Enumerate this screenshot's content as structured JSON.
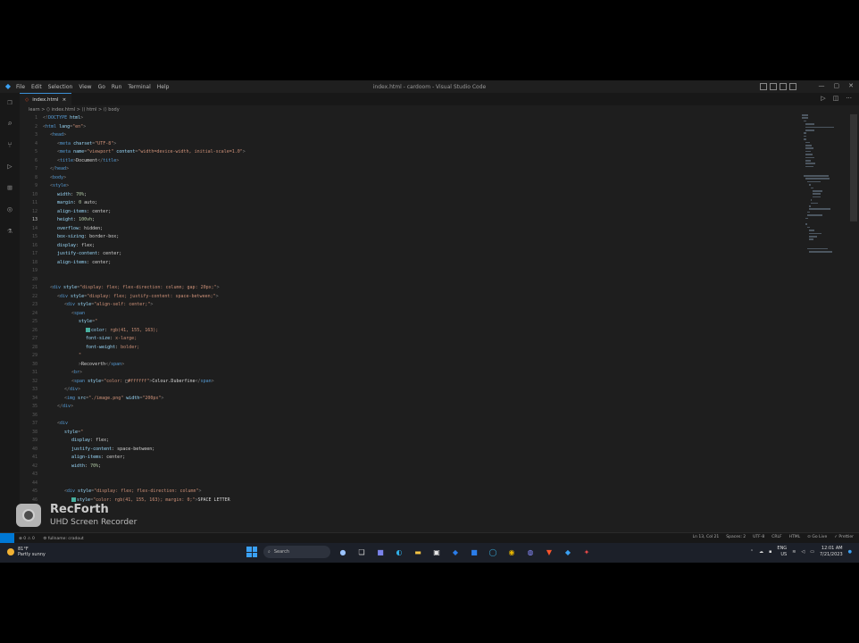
{
  "window": {
    "title": "index.html - cardoom - Visual Studio Code",
    "menu": [
      "File",
      "Edit",
      "Selection",
      "View",
      "Go",
      "Run",
      "Terminal",
      "Help"
    ]
  },
  "tabs": [
    {
      "label": "index.html",
      "icon": "html-file-icon",
      "close": "×"
    }
  ],
  "breadcrumb": "learn > ⟨⟩ index.html > ⟨⟩ html > ⟨⟩ body",
  "editor": {
    "active_line": 13,
    "lines": [
      {
        "n": 1,
        "indent": 0,
        "segs": [
          [
            "t-punc",
            "<!"
          ],
          [
            "t-tag",
            "DOCTYPE"
          ],
          [
            "t-attr",
            " html"
          ],
          [
            "t-punc",
            ">"
          ]
        ]
      },
      {
        "n": 2,
        "indent": 0,
        "segs": [
          [
            "t-punc",
            "<"
          ],
          [
            "t-tag",
            "html"
          ],
          [
            "t-attr",
            " lang"
          ],
          [
            "t-punc",
            "="
          ],
          [
            "t-str",
            "\"en\""
          ],
          [
            "t-punc",
            ">"
          ]
        ]
      },
      {
        "n": 3,
        "indent": 1,
        "segs": [
          [
            "t-punc",
            "<"
          ],
          [
            "t-tag",
            "head"
          ],
          [
            "t-punc",
            ">"
          ]
        ]
      },
      {
        "n": 4,
        "indent": 2,
        "segs": [
          [
            "t-punc",
            "<"
          ],
          [
            "t-tag",
            "meta"
          ],
          [
            "t-attr",
            " charset"
          ],
          [
            "t-punc",
            "="
          ],
          [
            "t-str",
            "\"UTF-8\""
          ],
          [
            "t-punc",
            ">"
          ]
        ]
      },
      {
        "n": 5,
        "indent": 2,
        "segs": [
          [
            "t-punc",
            "<"
          ],
          [
            "t-tag",
            "meta"
          ],
          [
            "t-attr",
            " name"
          ],
          [
            "t-punc",
            "="
          ],
          [
            "t-str",
            "\"viewport\""
          ],
          [
            "t-attr",
            " content"
          ],
          [
            "t-punc",
            "="
          ],
          [
            "t-str",
            "\"width=device-width, initial-scale=1.0\""
          ],
          [
            "t-punc",
            ">"
          ]
        ]
      },
      {
        "n": 6,
        "indent": 2,
        "segs": [
          [
            "t-punc",
            "<"
          ],
          [
            "t-tag",
            "title"
          ],
          [
            "t-punc",
            ">"
          ],
          [
            "t-txt",
            "Document"
          ],
          [
            "t-punc",
            "</"
          ],
          [
            "t-tag",
            "title"
          ],
          [
            "t-punc",
            ">"
          ]
        ]
      },
      {
        "n": 7,
        "indent": 1,
        "segs": [
          [
            "t-punc",
            "</"
          ],
          [
            "t-tag",
            "head"
          ],
          [
            "t-punc",
            ">"
          ]
        ]
      },
      {
        "n": 8,
        "indent": 1,
        "segs": [
          [
            "t-punc",
            "<"
          ],
          [
            "t-tag",
            "body"
          ],
          [
            "t-punc",
            ">"
          ]
        ]
      },
      {
        "n": 9,
        "indent": 1,
        "segs": [
          [
            "t-punc",
            "<"
          ],
          [
            "t-tag",
            "style"
          ],
          [
            "t-punc",
            ">"
          ]
        ]
      },
      {
        "n": 10,
        "indent": 2,
        "segs": [
          [
            "t-prop",
            "width"
          ],
          [
            "t-txt",
            ": "
          ],
          [
            "t-num",
            "70%"
          ],
          [
            "t-txt",
            ";"
          ]
        ]
      },
      {
        "n": 11,
        "indent": 2,
        "segs": [
          [
            "t-prop",
            "margin"
          ],
          [
            "t-txt",
            ": "
          ],
          [
            "t-num",
            "0"
          ],
          [
            "t-txt",
            " auto;"
          ]
        ]
      },
      {
        "n": 12,
        "indent": 2,
        "segs": [
          [
            "t-prop",
            "align-items"
          ],
          [
            "t-txt",
            ": center;"
          ]
        ]
      },
      {
        "n": 13,
        "indent": 2,
        "segs": [
          [
            "t-prop",
            "height"
          ],
          [
            "t-txt",
            ": "
          ],
          [
            "t-num",
            "100vh"
          ],
          [
            "t-txt",
            ";"
          ]
        ]
      },
      {
        "n": 14,
        "indent": 2,
        "segs": [
          [
            "t-prop",
            "overflow"
          ],
          [
            "t-txt",
            ": hidden;"
          ]
        ]
      },
      {
        "n": 15,
        "indent": 2,
        "segs": [
          [
            "t-prop",
            "box-sizing"
          ],
          [
            "t-txt",
            ": border-box;"
          ]
        ]
      },
      {
        "n": 16,
        "indent": 2,
        "segs": [
          [
            "t-prop",
            "display"
          ],
          [
            "t-txt",
            ": flex;"
          ]
        ]
      },
      {
        "n": 17,
        "indent": 2,
        "segs": [
          [
            "t-prop",
            "justify-content"
          ],
          [
            "t-txt",
            ": center;"
          ]
        ]
      },
      {
        "n": 18,
        "indent": 2,
        "segs": [
          [
            "t-prop",
            "align-items"
          ],
          [
            "t-txt",
            ": center;"
          ]
        ]
      },
      {
        "n": 19,
        "indent": 0,
        "segs": []
      },
      {
        "n": 20,
        "indent": 1,
        "segs": []
      },
      {
        "n": 21,
        "indent": 1,
        "segs": [
          [
            "t-punc",
            "<"
          ],
          [
            "t-tag",
            "div"
          ],
          [
            "t-attr",
            " style"
          ],
          [
            "t-punc",
            "="
          ],
          [
            "t-str",
            "\"display: flex; flex-direction: column; gap: 20px;\""
          ],
          [
            "t-punc",
            ">"
          ]
        ]
      },
      {
        "n": 22,
        "indent": 2,
        "segs": [
          [
            "t-punc",
            "<"
          ],
          [
            "t-tag",
            "div"
          ],
          [
            "t-attr",
            " style"
          ],
          [
            "t-punc",
            "="
          ],
          [
            "t-str",
            "\"display: flex; justify-content: space-between;\""
          ],
          [
            "t-punc",
            ">"
          ]
        ]
      },
      {
        "n": 23,
        "indent": 3,
        "segs": [
          [
            "t-punc",
            "<"
          ],
          [
            "t-tag",
            "div"
          ],
          [
            "t-attr",
            " style"
          ],
          [
            "t-punc",
            "="
          ],
          [
            "t-str",
            "\"align-self: center;\""
          ],
          [
            "t-punc",
            ">"
          ]
        ]
      },
      {
        "n": 24,
        "indent": 4,
        "segs": [
          [
            "t-punc",
            "<"
          ],
          [
            "t-tag",
            "span"
          ]
        ]
      },
      {
        "n": 25,
        "indent": 5,
        "segs": [
          [
            "t-attr",
            "style"
          ],
          [
            "t-punc",
            "="
          ],
          [
            "t-str",
            "\""
          ]
        ]
      },
      {
        "n": 26,
        "indent": 6,
        "swatch": true,
        "segs": [
          [
            "t-prop",
            "color"
          ],
          [
            "t-txt",
            ": "
          ],
          [
            "t-str",
            "rgb(41, 155, 163);"
          ]
        ]
      },
      {
        "n": 27,
        "indent": 6,
        "segs": [
          [
            "t-prop",
            "font-size"
          ],
          [
            "t-txt",
            ": "
          ],
          [
            "t-str",
            "x-large;"
          ]
        ]
      },
      {
        "n": 28,
        "indent": 6,
        "segs": [
          [
            "t-prop",
            "font-weight"
          ],
          [
            "t-txt",
            ": "
          ],
          [
            "t-str",
            "bolder;"
          ]
        ]
      },
      {
        "n": 29,
        "indent": 5,
        "segs": [
          [
            "t-str",
            "\""
          ]
        ]
      },
      {
        "n": 30,
        "indent": 5,
        "segs": [
          [
            "t-punc",
            ">"
          ],
          [
            "t-txt",
            "Recoverth"
          ],
          [
            "t-punc",
            "</"
          ],
          [
            "t-tag",
            "span"
          ],
          [
            "t-punc",
            ">"
          ]
        ]
      },
      {
        "n": 31,
        "indent": 4,
        "segs": [
          [
            "t-punc",
            "<"
          ],
          [
            "t-tag",
            "br"
          ],
          [
            "t-punc",
            ">"
          ]
        ]
      },
      {
        "n": 32,
        "indent": 4,
        "segs": [
          [
            "t-punc",
            "<"
          ],
          [
            "t-tag",
            "span"
          ],
          [
            "t-attr",
            " style"
          ],
          [
            "t-punc",
            "="
          ],
          [
            "t-str",
            "\"color: "
          ],
          [
            "t-txt",
            "□"
          ],
          [
            "t-str",
            "#ffffff\""
          ],
          [
            "t-punc",
            ">"
          ],
          [
            "t-txt",
            "Colour.Duberfine"
          ],
          [
            "t-punc",
            "</"
          ],
          [
            "t-tag",
            "span"
          ],
          [
            "t-punc",
            ">"
          ]
        ]
      },
      {
        "n": 33,
        "indent": 3,
        "segs": [
          [
            "t-punc",
            "</"
          ],
          [
            "t-tag",
            "div"
          ],
          [
            "t-punc",
            ">"
          ]
        ]
      },
      {
        "n": 34,
        "indent": 3,
        "segs": [
          [
            "t-punc",
            "<"
          ],
          [
            "t-tag",
            "img"
          ],
          [
            "t-attr",
            " src"
          ],
          [
            "t-punc",
            "="
          ],
          [
            "t-str",
            "\"./image.png\""
          ],
          [
            "t-attr",
            " width"
          ],
          [
            "t-punc",
            "="
          ],
          [
            "t-str",
            "\"200px\""
          ],
          [
            "t-punc",
            ">"
          ]
        ]
      },
      {
        "n": 35,
        "indent": 2,
        "segs": [
          [
            "t-punc",
            "</"
          ],
          [
            "t-tag",
            "div"
          ],
          [
            "t-punc",
            ">"
          ]
        ]
      },
      {
        "n": 36,
        "indent": 2,
        "segs": []
      },
      {
        "n": 37,
        "indent": 2,
        "segs": [
          [
            "t-punc",
            "<"
          ],
          [
            "t-tag",
            "div"
          ]
        ]
      },
      {
        "n": 38,
        "indent": 3,
        "segs": [
          [
            "t-attr",
            "style"
          ],
          [
            "t-punc",
            "="
          ],
          [
            "t-str",
            "\""
          ]
        ]
      },
      {
        "n": 39,
        "indent": 4,
        "segs": [
          [
            "t-prop",
            "display"
          ],
          [
            "t-txt",
            ": flex;"
          ]
        ]
      },
      {
        "n": 40,
        "indent": 4,
        "segs": [
          [
            "t-prop",
            "justify-content"
          ],
          [
            "t-txt",
            ": space-between;"
          ]
        ]
      },
      {
        "n": 41,
        "indent": 4,
        "segs": [
          [
            "t-prop",
            "align-items"
          ],
          [
            "t-txt",
            ": center;"
          ]
        ]
      },
      {
        "n": 42,
        "indent": 4,
        "segs": [
          [
            "t-prop",
            "width"
          ],
          [
            "t-txt",
            ": "
          ],
          [
            "t-num",
            "70%"
          ],
          [
            "t-txt",
            ";"
          ]
        ]
      },
      {
        "n": 43,
        "indent": 3,
        "segs": []
      },
      {
        "n": 44,
        "indent": 3,
        "segs": []
      },
      {
        "n": 45,
        "indent": 3,
        "segs": [
          [
            "t-punc",
            "<"
          ],
          [
            "t-tag",
            "div"
          ],
          [
            "t-attr",
            " style"
          ],
          [
            "t-punc",
            "="
          ],
          [
            "t-str",
            "\"display: flex; flex-direction: column\""
          ],
          [
            "t-punc",
            ">"
          ]
        ]
      },
      {
        "n": 46,
        "indent": 4,
        "swatch": true,
        "segs": [
          [
            "t-attr",
            "style"
          ],
          [
            "t-punc",
            "="
          ],
          [
            "t-str",
            "\"color: "
          ],
          [
            "t-str",
            "rgb(41, 155, 163); margin: 0;\""
          ],
          [
            "t-punc",
            ">"
          ],
          [
            "t-txt",
            "SPACE LETTER"
          ]
        ]
      }
    ]
  },
  "statusbar": {
    "left": [
      "⊗ 0 ⚠ 0",
      "⚙ fullname: cradout"
    ],
    "right": [
      "Ln 13, Col 21",
      "Spaces: 2",
      "UTF-8",
      "CRLF",
      "HTML",
      "⊙ Go Live",
      "✓ Prettier"
    ]
  },
  "taskbar": {
    "weather_temp": "81°F",
    "weather_desc": "Partly sunny",
    "search_label": "Search",
    "lang": [
      "ENG",
      "US"
    ],
    "time": "12:01 AM",
    "date": "7/21/2023"
  },
  "watermark": {
    "name": "RecForth",
    "subtitle": "UHD Screen Recorder"
  },
  "colors": {
    "accent": "#0078d4",
    "editor_bg": "#1e1e1e"
  }
}
